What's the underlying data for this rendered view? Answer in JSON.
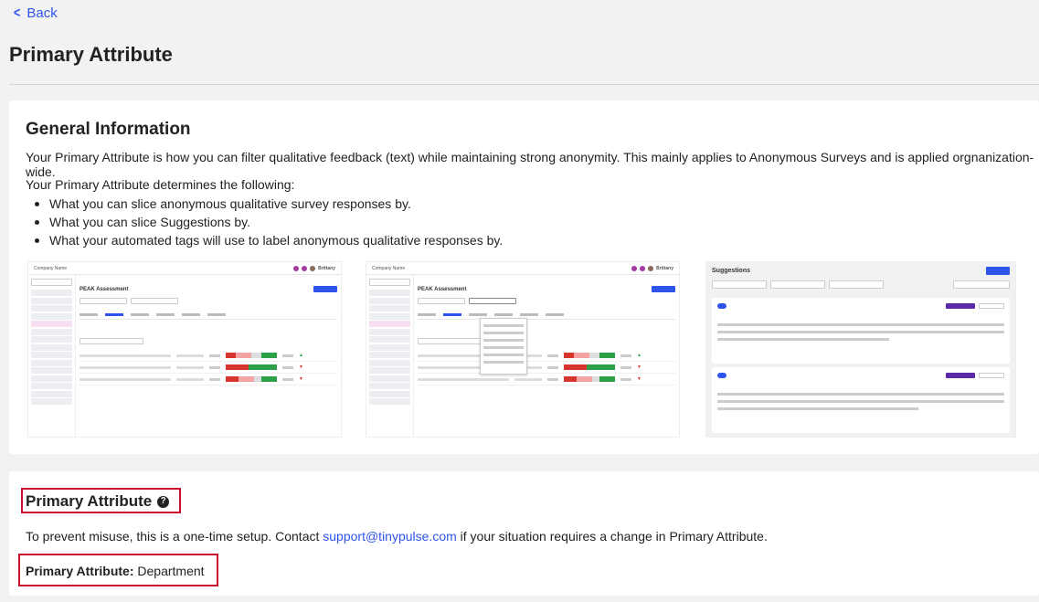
{
  "nav": {
    "back_label": "Back"
  },
  "page": {
    "title": "Primary Attribute"
  },
  "general": {
    "heading": "General Information",
    "intro": "Your Primary Attribute is how you can filter qualitative feedback (text) while maintaining strong anonymity. This mainly applies to Anonymous Surveys and is applied orgnanization-wide.",
    "determines": "Your Primary Attribute determines the following:",
    "bullets": [
      "What you can slice anonymous qualitative survey responses by.",
      "What you can slice Suggestions by.",
      "What your automated tags will use to label anonymous qualitative responses by."
    ],
    "thumbnails": {
      "company_name": "Company Name",
      "user": "Brittany",
      "assessment_title": "PEAK Assessment",
      "suggestions_title": "Suggestions"
    }
  },
  "primary": {
    "heading": "Primary Attribute",
    "note_before": "To prevent misuse, this is a one-time setup. Contact ",
    "email": "support@tinypulse.com",
    "note_after": " if your situation requires a change in Primary Attribute.",
    "label": "Primary Attribute:",
    "value": "Department"
  },
  "colors": {
    "accent": "#2f54eb",
    "highlight_border": "#c8102e"
  }
}
